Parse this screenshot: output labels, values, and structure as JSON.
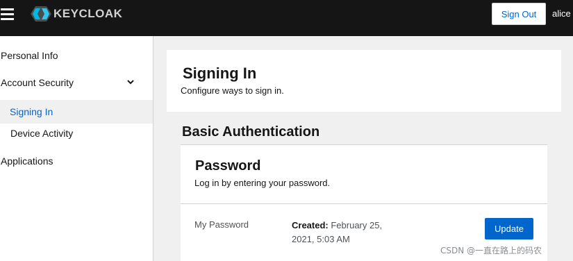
{
  "header": {
    "brand": "KEYCLOAK",
    "signout_label": "Sign Out",
    "username": "alice"
  },
  "sidebar": {
    "items": [
      {
        "label": "Personal Info"
      },
      {
        "label": "Account Security"
      },
      {
        "label": "Signing In"
      },
      {
        "label": "Device Activity"
      },
      {
        "label": "Applications"
      }
    ]
  },
  "main": {
    "title": "Signing In",
    "subtitle": "Configure ways to sign in.",
    "section_title": "Basic Authentication",
    "password_card": {
      "title": "Password",
      "description": "Log in by entering your password.",
      "credential_label": "My Password",
      "created_label": "Created:",
      "created_value": " February 25, 2021, 5:03 AM",
      "update_label": "Update"
    }
  },
  "watermark": "CSDN @一直在路上的码农",
  "colors": {
    "header_bg": "#151515",
    "accent": "#0066cc",
    "page_bg": "#f0f0f0"
  },
  "icons": [
    "hamburger-icon",
    "keycloak-logo-icon",
    "chevron-down-icon"
  ]
}
